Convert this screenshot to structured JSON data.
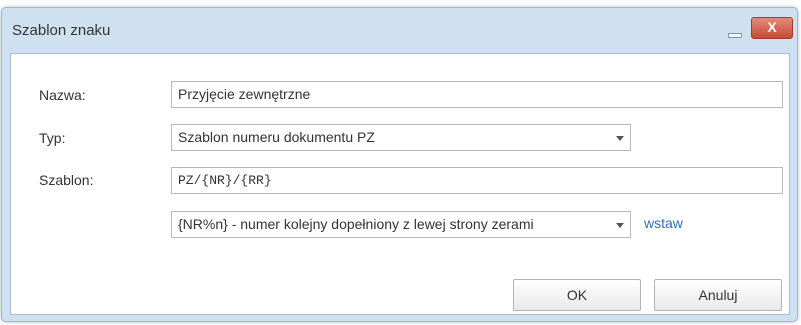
{
  "dialog": {
    "title": "Szablon znaku",
    "close_glyph": "X"
  },
  "form": {
    "name_label": "Nazwa:",
    "name_value": "Przyjęcie zewnętrzne",
    "type_label": "Typ:",
    "type_value": "Szablon numeru dokumentu PZ",
    "template_label": "Szablon:",
    "template_value": "PZ/{NR}/{RR}",
    "placeholder_select_value": "{NR%n} - numer kolejny dopełniony z lewej strony zerami",
    "insert_link": "wstaw"
  },
  "buttons": {
    "ok": "OK",
    "cancel": "Anuluj"
  },
  "colors": {
    "titlebar": "#cfe0f1",
    "link": "#2a6ebb",
    "close_button": "#c94a36"
  },
  "icons": [
    "minimize-icon",
    "close-icon",
    "dropdown-caret-icon"
  ]
}
